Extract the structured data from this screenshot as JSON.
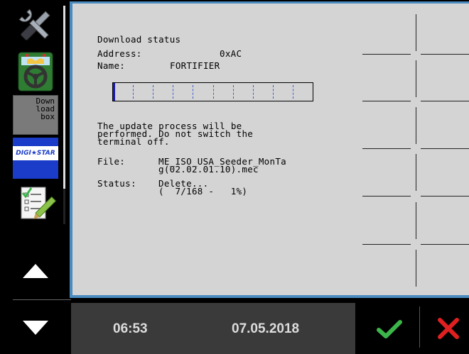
{
  "sidebar": {
    "download_box_label": "Down\nload\n box",
    "digistar_label": "DIGI★STAR"
  },
  "status": {
    "title": "Download status",
    "address_label": "Address:",
    "address_value": "0xAC",
    "name_label": "Name:",
    "name_value": "FORTIFIER",
    "progress_percent": 1,
    "message": "The update process will be\nperformed. Do not switch the\nterminal off.",
    "file_label": "File:",
    "file_value": "ME_ISO_USA_Seeder_MonTa\ng(02.02.01.10).mec",
    "status_label": "Status:",
    "status_value": "Delete...\n(  7/168 -   1%)"
  },
  "footer": {
    "time": "06:53",
    "date": "07.05.2018"
  },
  "colors": {
    "accent_blue": "#4a8bc0",
    "ok_green": "#3cb64a",
    "cancel_red": "#e02020",
    "progress_fill": "#1a1ab0"
  },
  "icons": [
    "tools-icon",
    "gps-steering-icon",
    "digistar-logo",
    "checklist-edit-icon",
    "arrow-up-icon",
    "arrow-down-icon",
    "checkmark-icon",
    "close-icon"
  ]
}
